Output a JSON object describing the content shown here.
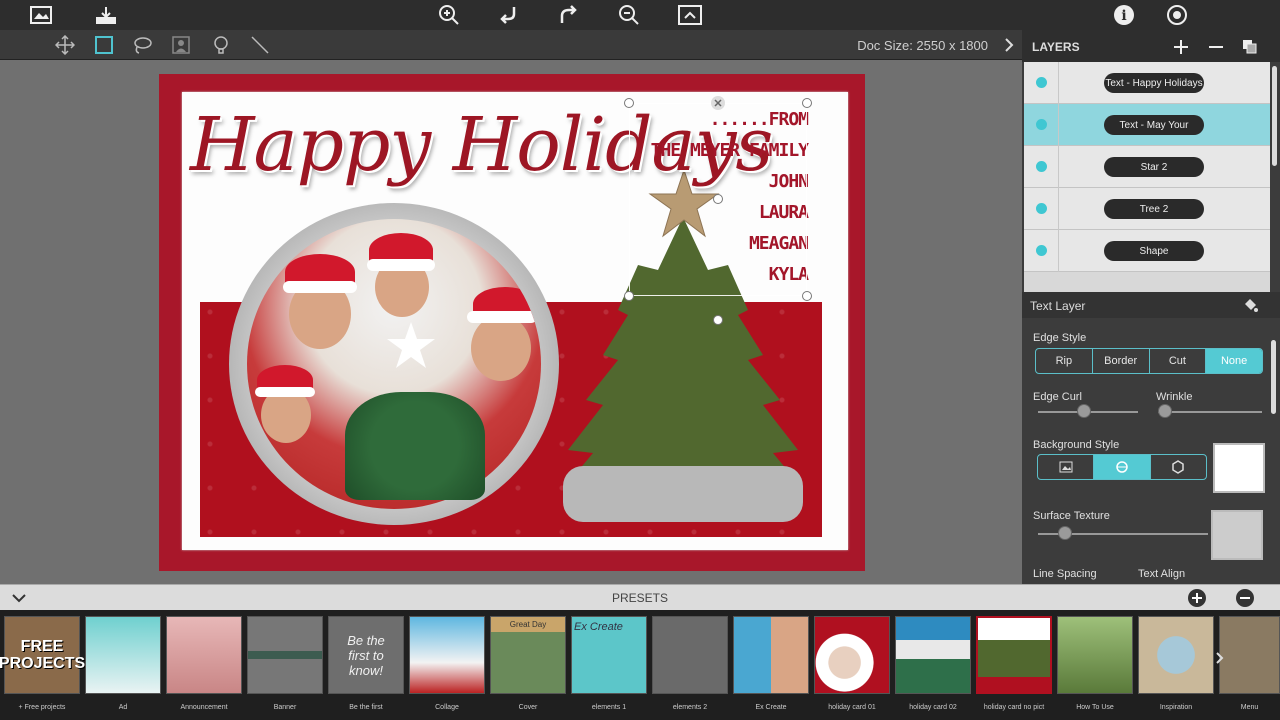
{
  "toolbar": {
    "doc_size": "Doc Size: 2550 x 1800"
  },
  "card": {
    "title_art": "Happy Holidays",
    "names": [
      "......FROM",
      "THE MEYER FAMILY",
      "JOHN",
      "LAURA",
      "MEAGAN",
      "KYLA"
    ]
  },
  "layers_panel": {
    "title": "LAYERS",
    "items": [
      {
        "label": "Text - Happy Holidays"
      },
      {
        "label": "Text - May Your"
      },
      {
        "label": "Star 2"
      },
      {
        "label": "Tree 2"
      },
      {
        "label": "Shape"
      }
    ],
    "active_index": 1
  },
  "text_layer": {
    "title": "Text Layer",
    "edge_style_label": "Edge Style",
    "edge_style_options": [
      "Rip",
      "Border",
      "Cut",
      "None"
    ],
    "edge_style_selected": "None",
    "edge_curl_label": "Edge Curl",
    "wrinkle_label": "Wrinkle",
    "background_style_label": "Background Style",
    "surface_texture_label": "Surface Texture",
    "line_spacing_label": "Line Spacing",
    "text_align_label": "Text Align",
    "accent_color": "#54cad3"
  },
  "presets": {
    "title": "PRESETS",
    "items": [
      {
        "label": "+ Free projects"
      },
      {
        "label": "Ad"
      },
      {
        "label": "Announcement"
      },
      {
        "label": "Banner"
      },
      {
        "label": "Be the first"
      },
      {
        "label": "Collage"
      },
      {
        "label": "Cover"
      },
      {
        "label": "elements 1"
      },
      {
        "label": "elements 2"
      },
      {
        "label": "Ex Create"
      },
      {
        "label": "holiday card 01"
      },
      {
        "label": "holiday card 02"
      },
      {
        "label": "holiday card no pict"
      },
      {
        "label": "How To Use"
      },
      {
        "label": "Inspiration"
      },
      {
        "label": "Menu"
      }
    ],
    "thumb_texts": {
      "free_projects": "FREE PROJECTS",
      "be_the_first": "Be the first to know!",
      "ex_create": "Ex Create",
      "great_day": "Great Day"
    }
  }
}
